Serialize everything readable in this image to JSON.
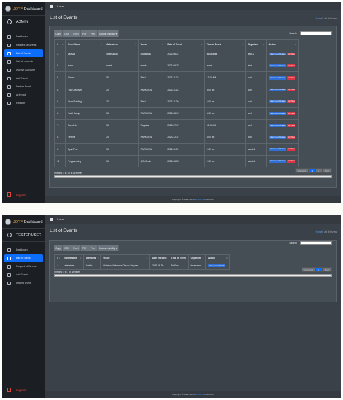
{
  "admin_view": {
    "brand": {
      "accent": "JOYF",
      "rest": " Dashboard"
    },
    "user": "ADMIN",
    "nav": [
      "Dashboard",
      "Request of Events",
      "List of Events",
      "List of Accounts",
      "Inactive Accounts",
      "Add Event",
      "Decline Event",
      "Archived",
      "Register"
    ],
    "logout": "Logout",
    "topbar": {
      "home": "Home"
    },
    "page_title": "List of Events",
    "breadcrumb": {
      "home": "Home",
      "sep": " / ",
      "current": "List of Events"
    },
    "buttons": [
      "Copy",
      "CSV",
      "Excel",
      "PDF",
      "Print",
      "Column visibility ▾"
    ],
    "search_label": "Search:",
    "columns": [
      "#",
      "Event Name",
      "Attendees",
      "Venue",
      "Date of Event",
      "Time of Event",
      "Organizer",
      "Action"
    ],
    "rows": [
      [
        "1.",
        "sadsad",
        "dsadsadsa",
        "dsadsadsa",
        "2023-06-21",
        "dsadsadsa",
        "test12"
      ],
      [
        "2.",
        "event",
        "event",
        "event",
        "2023-06-27",
        "event",
        "test"
      ],
      [
        "3.",
        "Dinner",
        "50",
        "Rizal",
        "2023-11-22",
        "12:00 AM",
        "carl"
      ],
      [
        "4.",
        "Fully Deployed",
        "20",
        "PARKVIEW",
        "2023-11-18",
        "3:00 pm",
        "carl"
      ],
      [
        "5.",
        "Team Building",
        "20",
        "Rizal",
        "2023-11-30",
        "4:00 pm",
        "carl"
      ],
      [
        "6.",
        "Youth Camp",
        "50",
        "PARKVIEW",
        "2023-08-12",
        "3:00 pm",
        "carl"
      ],
      [
        "7.",
        "Rave Life",
        "50",
        "Payatas",
        "2023-07-17",
        "12:00 AM",
        "carl"
      ],
      [
        "8.",
        "Festival",
        "20",
        "PARKVIEW",
        "2023-12-17",
        "8:00 am",
        "carl"
      ],
      [
        "9.",
        "SparkFest",
        "50",
        "PARKVIEW",
        "2023-11-09",
        "2:00 pm",
        "admin1"
      ],
      [
        "10.",
        "Programming",
        "50",
        "QC, Circle",
        "2023-06-25",
        "2:00 pm",
        "admin1"
      ]
    ],
    "view_btn": "View Event Details",
    "delete_btn": "Archive",
    "info": "Showing 1 to 10 of 11 entries",
    "pager": [
      "Previous",
      "1",
      "2",
      "Next"
    ],
    "footer": {
      "pre": "Copyright © 2023-2023 ",
      "link": "MILESTONE",
      "post": " GROUP"
    }
  },
  "tester_view": {
    "brand": {
      "accent": "JOYF",
      "rest": " Dashboard"
    },
    "user": "TESTERUSER",
    "nav": [
      "Dashboard",
      "List of Events",
      "Request of Events",
      "Add Event",
      "Decline Event"
    ],
    "logout": "Logout",
    "topbar": {
      "home": "Home"
    },
    "page_title": "List of Events",
    "breadcrumb": {
      "home": "Home",
      "sep": " / ",
      "current": "List of Events"
    },
    "buttons": [
      "Copy",
      "CSV",
      "Excel",
      "PDF",
      "Print",
      "Column visibility ▾"
    ],
    "search_label": "Search:",
    "columns": [
      "#",
      "Event Name",
      "Attendees",
      "Venue",
      "Date of Event",
      "Time of Event",
      "Organizer",
      "Action"
    ],
    "rows": [
      [
        "1.",
        "attendees",
        "Youths",
        "Christian Reformed Church Payatas",
        "2023-06-30",
        "9:00pm",
        "testeruser"
      ]
    ],
    "view_btn": "View Event Details",
    "info": "Showing 1 to 1 of 1 entries",
    "pager": [
      "Previous",
      "1",
      "Next"
    ],
    "footer": {
      "pre": "Copyright © 2023-2023 ",
      "link": "MILESTONE",
      "post": " GROUP"
    }
  }
}
